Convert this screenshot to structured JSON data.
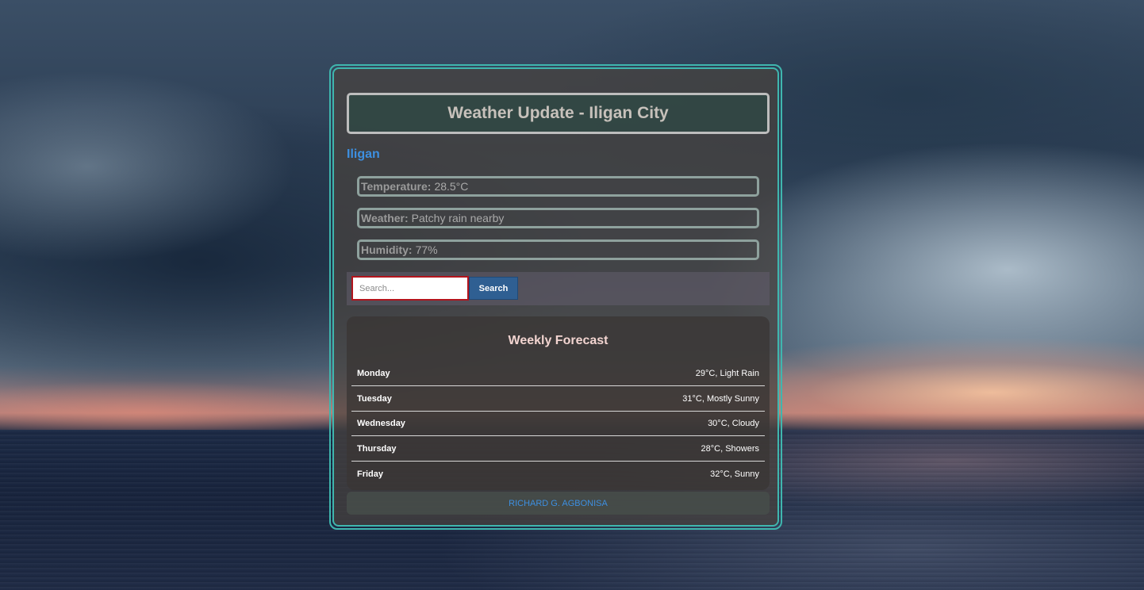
{
  "header": {
    "title": "Weather Update - Iligan City"
  },
  "current": {
    "city": "Iligan",
    "temperature_label": "Temperature:",
    "temperature_value": "28.5°C",
    "weather_label": "Weather:",
    "weather_value": "Patchy rain nearby",
    "humidity_label": "Humidity:",
    "humidity_value": "77%"
  },
  "search": {
    "placeholder": "Search...",
    "button_label": "Search"
  },
  "forecast": {
    "title": "Weekly Forecast",
    "days": [
      {
        "day": "Monday",
        "value": "29°C, Light Rain"
      },
      {
        "day": "Tuesday",
        "value": "31°C, Mostly Sunny"
      },
      {
        "day": "Wednesday",
        "value": "30°C, Cloudy"
      },
      {
        "day": "Thursday",
        "value": "28°C, Showers"
      },
      {
        "day": "Friday",
        "value": "32°C, Sunny"
      }
    ]
  },
  "footer": {
    "author": "RICHARD G. AGBONISA"
  },
  "colors": {
    "accent_border": "#3fb6ae",
    "link_blue": "#3d8fe0",
    "search_button": "#2f5f92",
    "input_border": "#b3141c"
  }
}
